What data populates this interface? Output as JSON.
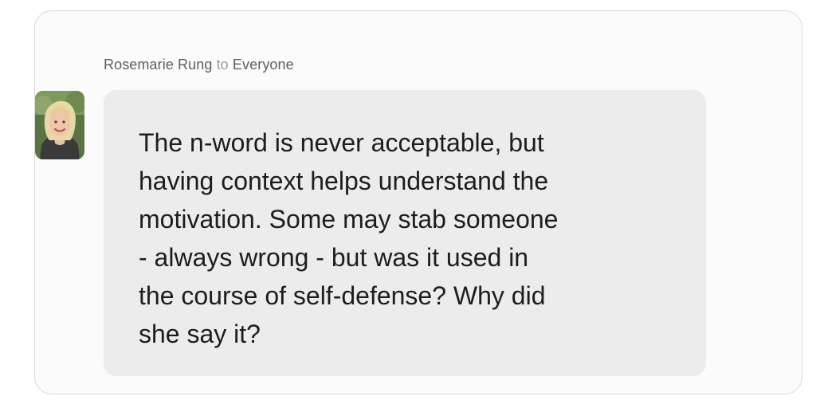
{
  "chat": {
    "sender_name": "Rosemarie Rung",
    "to_word": "to",
    "recipient": "Everyone",
    "avatar_icon": "user-photo-avatar",
    "message": "The n-word is never acceptable, but\nhaving context helps understand the\nmotivation. Some may stab someone\n- always wrong - but was it used in\nthe course of self-defense? Why did\nshe say it?"
  },
  "colors": {
    "bubble_background": "#ececed",
    "card_background": "#fbfbfb",
    "text": "#1d1d1d",
    "meta_text": "#6d6d6d"
  }
}
